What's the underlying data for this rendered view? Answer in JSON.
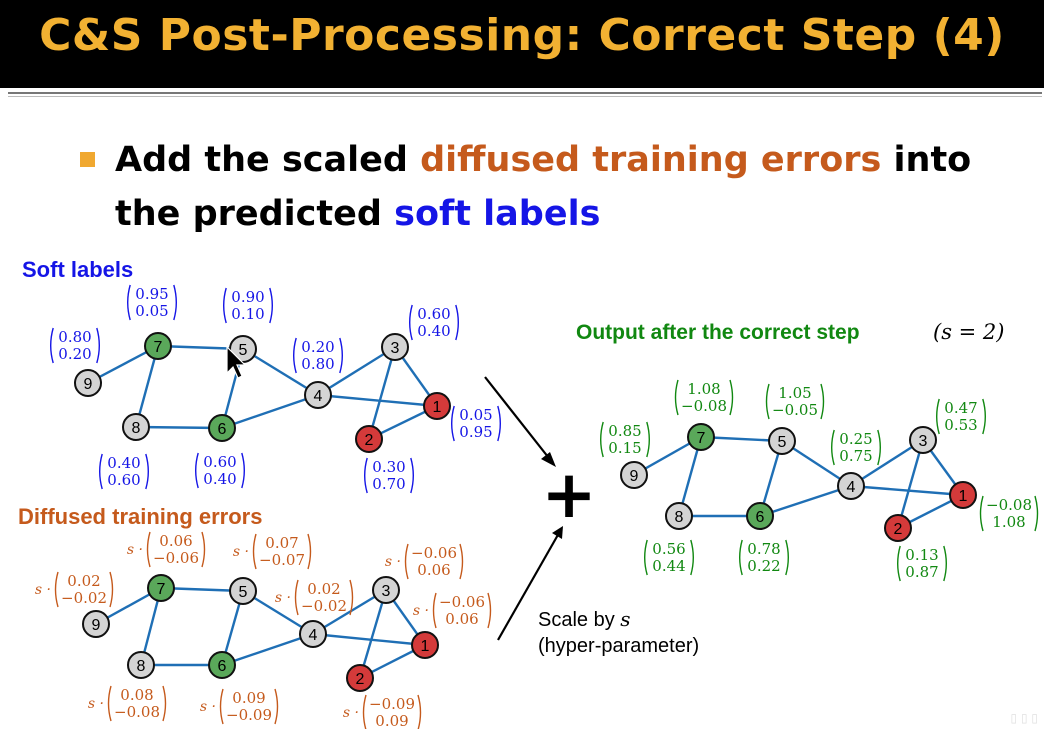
{
  "title": "C&S Post-Processing: Correct Step (4)",
  "bullet": {
    "line1_a": "Add the scaled ",
    "line1_highlight": "diffused training errors",
    "line1_b": " into",
    "line2_a": "the predicted ",
    "line2_highlight": "soft labels"
  },
  "soft_graph": {
    "heading": "Soft labels",
    "labels": {
      "n7": [
        "0.95",
        "0.05"
      ],
      "n5": [
        "0.90",
        "0.10"
      ],
      "n9": [
        "0.80",
        "0.20"
      ],
      "n4": [
        "0.20",
        "0.80"
      ],
      "n3": [
        "0.60",
        "0.40"
      ],
      "n1": [
        "0.05",
        "0.95"
      ],
      "n8": [
        "0.40",
        "0.60"
      ],
      "n6": [
        "0.60",
        "0.40"
      ],
      "n2": [
        "0.30",
        "0.70"
      ]
    }
  },
  "error_graph": {
    "heading": "Diffused training errors",
    "scale_prefix": "s ·",
    "labels": {
      "n7": [
        "0.06",
        "−0.06"
      ],
      "n5": [
        "0.07",
        "−0.07"
      ],
      "n9": [
        "0.02",
        "−0.02"
      ],
      "n4": [
        "0.02",
        "−0.02"
      ],
      "n3": [
        "−0.06",
        "0.06"
      ],
      "n1": [
        "−0.06",
        "0.06"
      ],
      "n8": [
        "0.08",
        "−0.08"
      ],
      "n6": [
        "0.09",
        "−0.09"
      ],
      "n2": [
        "−0.09",
        "0.09"
      ]
    }
  },
  "output_graph": {
    "heading": "Output after the correct step",
    "heading_formula": "(s = 2)",
    "labels": {
      "n7": [
        "1.08",
        "−0.08"
      ],
      "n5": [
        "1.05",
        "−0.05"
      ],
      "n9": [
        "0.85",
        "0.15"
      ],
      "n4": [
        "0.25",
        "0.75"
      ],
      "n3": [
        "0.47",
        "0.53"
      ],
      "n1": [
        "−0.08",
        "1.08"
      ],
      "n8": [
        "0.56",
        "0.44"
      ],
      "n6": [
        "0.78",
        "0.22"
      ],
      "n2": [
        "0.13",
        "0.87"
      ]
    }
  },
  "node_ids": {
    "n1": "1",
    "n2": "2",
    "n3": "3",
    "n4": "4",
    "n5": "5",
    "n6": "6",
    "n7": "7",
    "n8": "8",
    "n9": "9"
  },
  "operator": "+",
  "scale_note": {
    "line1": "Scale by ",
    "line1_var": "s",
    "line2": "(hyper-parameter)"
  },
  "colors": {
    "title": "#f2b132",
    "soft_text": "#1515e6",
    "error_text": "#c55a1c",
    "output_text": "#118811",
    "edge": "#1f6fb5",
    "node_green": "#5aa85a",
    "node_red": "#d43a3a",
    "node_gray": "#d4d4d4"
  }
}
